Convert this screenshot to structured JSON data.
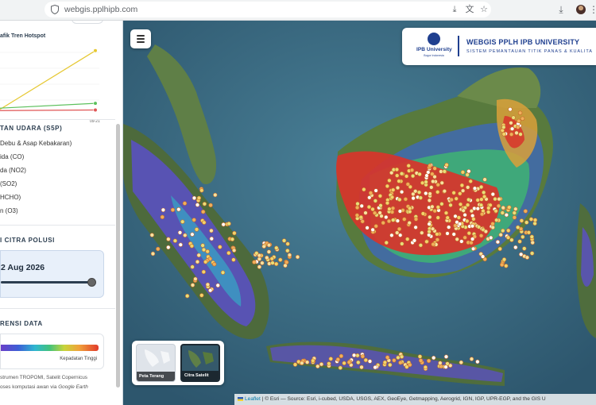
{
  "browser": {
    "url": "webgis.pplhipb.com",
    "icons": [
      "shield-icon",
      "download-icon",
      "translate-icon",
      "star-icon",
      "download-icon",
      "avatar",
      "more-icon"
    ]
  },
  "panel": {
    "chart_title": "afik Tren Hotspot",
    "section_air": "TAN UDARA (S5P)",
    "air_layers": [
      "Debu & Asap Kebakaran)",
      "ida (CO)",
      "da (NO2)",
      "(SO2)",
      "HCHO)",
      "n (O3)"
    ],
    "section_citra": "I CITRA POLUSI",
    "date_value": "2 Aug 2026",
    "slider_position": 1.0,
    "section_ref": "RENSI DATA",
    "legend_high": "Kepadatan Tinggi",
    "note_line1": "strumen TROPOMI, Satelit Copernicus",
    "note_line2_a": "oses komputasi awan via ",
    "note_line2_b": "Google Earth"
  },
  "chart_data": {
    "type": "line",
    "title": "afik Tren Hotspot",
    "x": [
      "",
      "09-21"
    ],
    "series": [
      {
        "color": "#e6c832",
        "values": [
          3,
          100
        ]
      },
      {
        "color": "#5cc05c",
        "values": [
          5,
          13
        ]
      },
      {
        "color": "#e05555",
        "values": [
          1,
          2
        ]
      }
    ],
    "ylim": [
      0,
      105
    ]
  },
  "map": {
    "brand_title": "WEBGIS PPLH IPB UNIVERSITY",
    "brand_subtitle": "SISTEM PEMANTAUAN TITIK PANAS & KUALITA",
    "logo_name": "IPB University",
    "logo_tagline": "Bogor Indonesia",
    "basemap_light": "Peta Terang",
    "basemap_sat": "Citra Satelit",
    "attrib_leaflet": "Leaflet",
    "attrib_rest": "| © Esri — Source: Esri, i-cubed, USDA, USGS, AEX, GeoEye, Getmapping, Aerogrid, IGN, IGP, UPR-EGP, and the GIS U"
  }
}
